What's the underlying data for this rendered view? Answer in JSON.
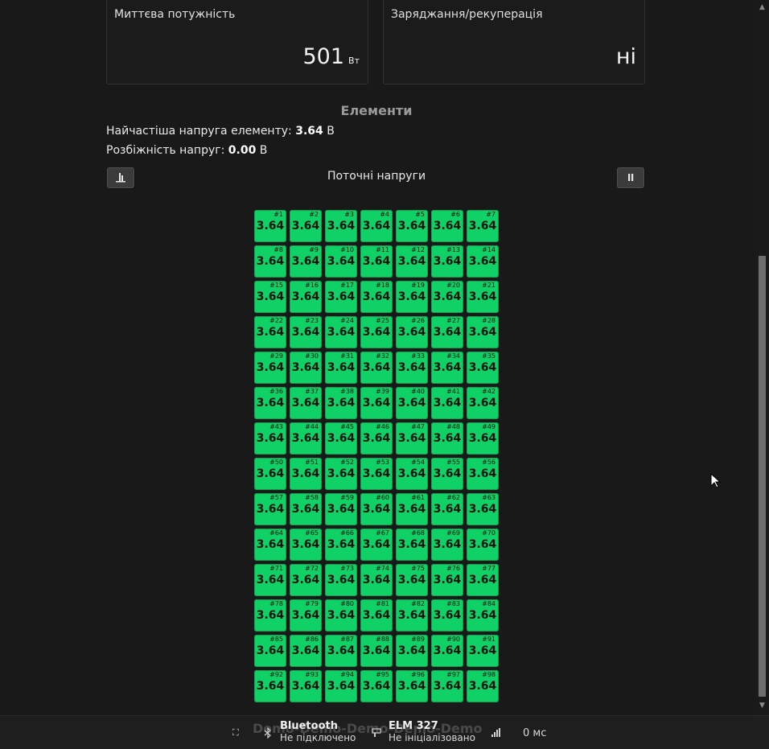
{
  "power_card": {
    "label": "Миттєва потужність",
    "value": "501",
    "unit": "Вт"
  },
  "charging_card": {
    "label": "Заряджання/рекуперація",
    "value": "ні"
  },
  "section": {
    "title": "Елементи",
    "most_common_label": "Найчастіша напруга елементу: ",
    "most_common_value": "3.64",
    "most_common_unit": " В",
    "spread_label": "Розбіжність напруг: ",
    "spread_value": "0.00",
    "spread_unit": " В"
  },
  "chart": {
    "subtitle": "Поточні напруги",
    "cell_voltage": "3.64",
    "cell_count": 98,
    "cell_color": "#0fd166"
  },
  "icons": {
    "chart_toggle": "bar-chart-icon",
    "pause": "pause-icon",
    "expand": "expand-icon",
    "bluetooth": "bluetooth-icon",
    "adapter": "obd-adapter-icon",
    "signal": "signal-icon"
  },
  "statusbar": {
    "watermark": "Demo-Demo-Demo-Demo-Demo",
    "bluetooth_title": "Bluetooth",
    "bluetooth_status": "Не підключено",
    "elm_title": "ELM 327",
    "elm_status": "Не ініціалізовано",
    "latency": "0 мс"
  }
}
